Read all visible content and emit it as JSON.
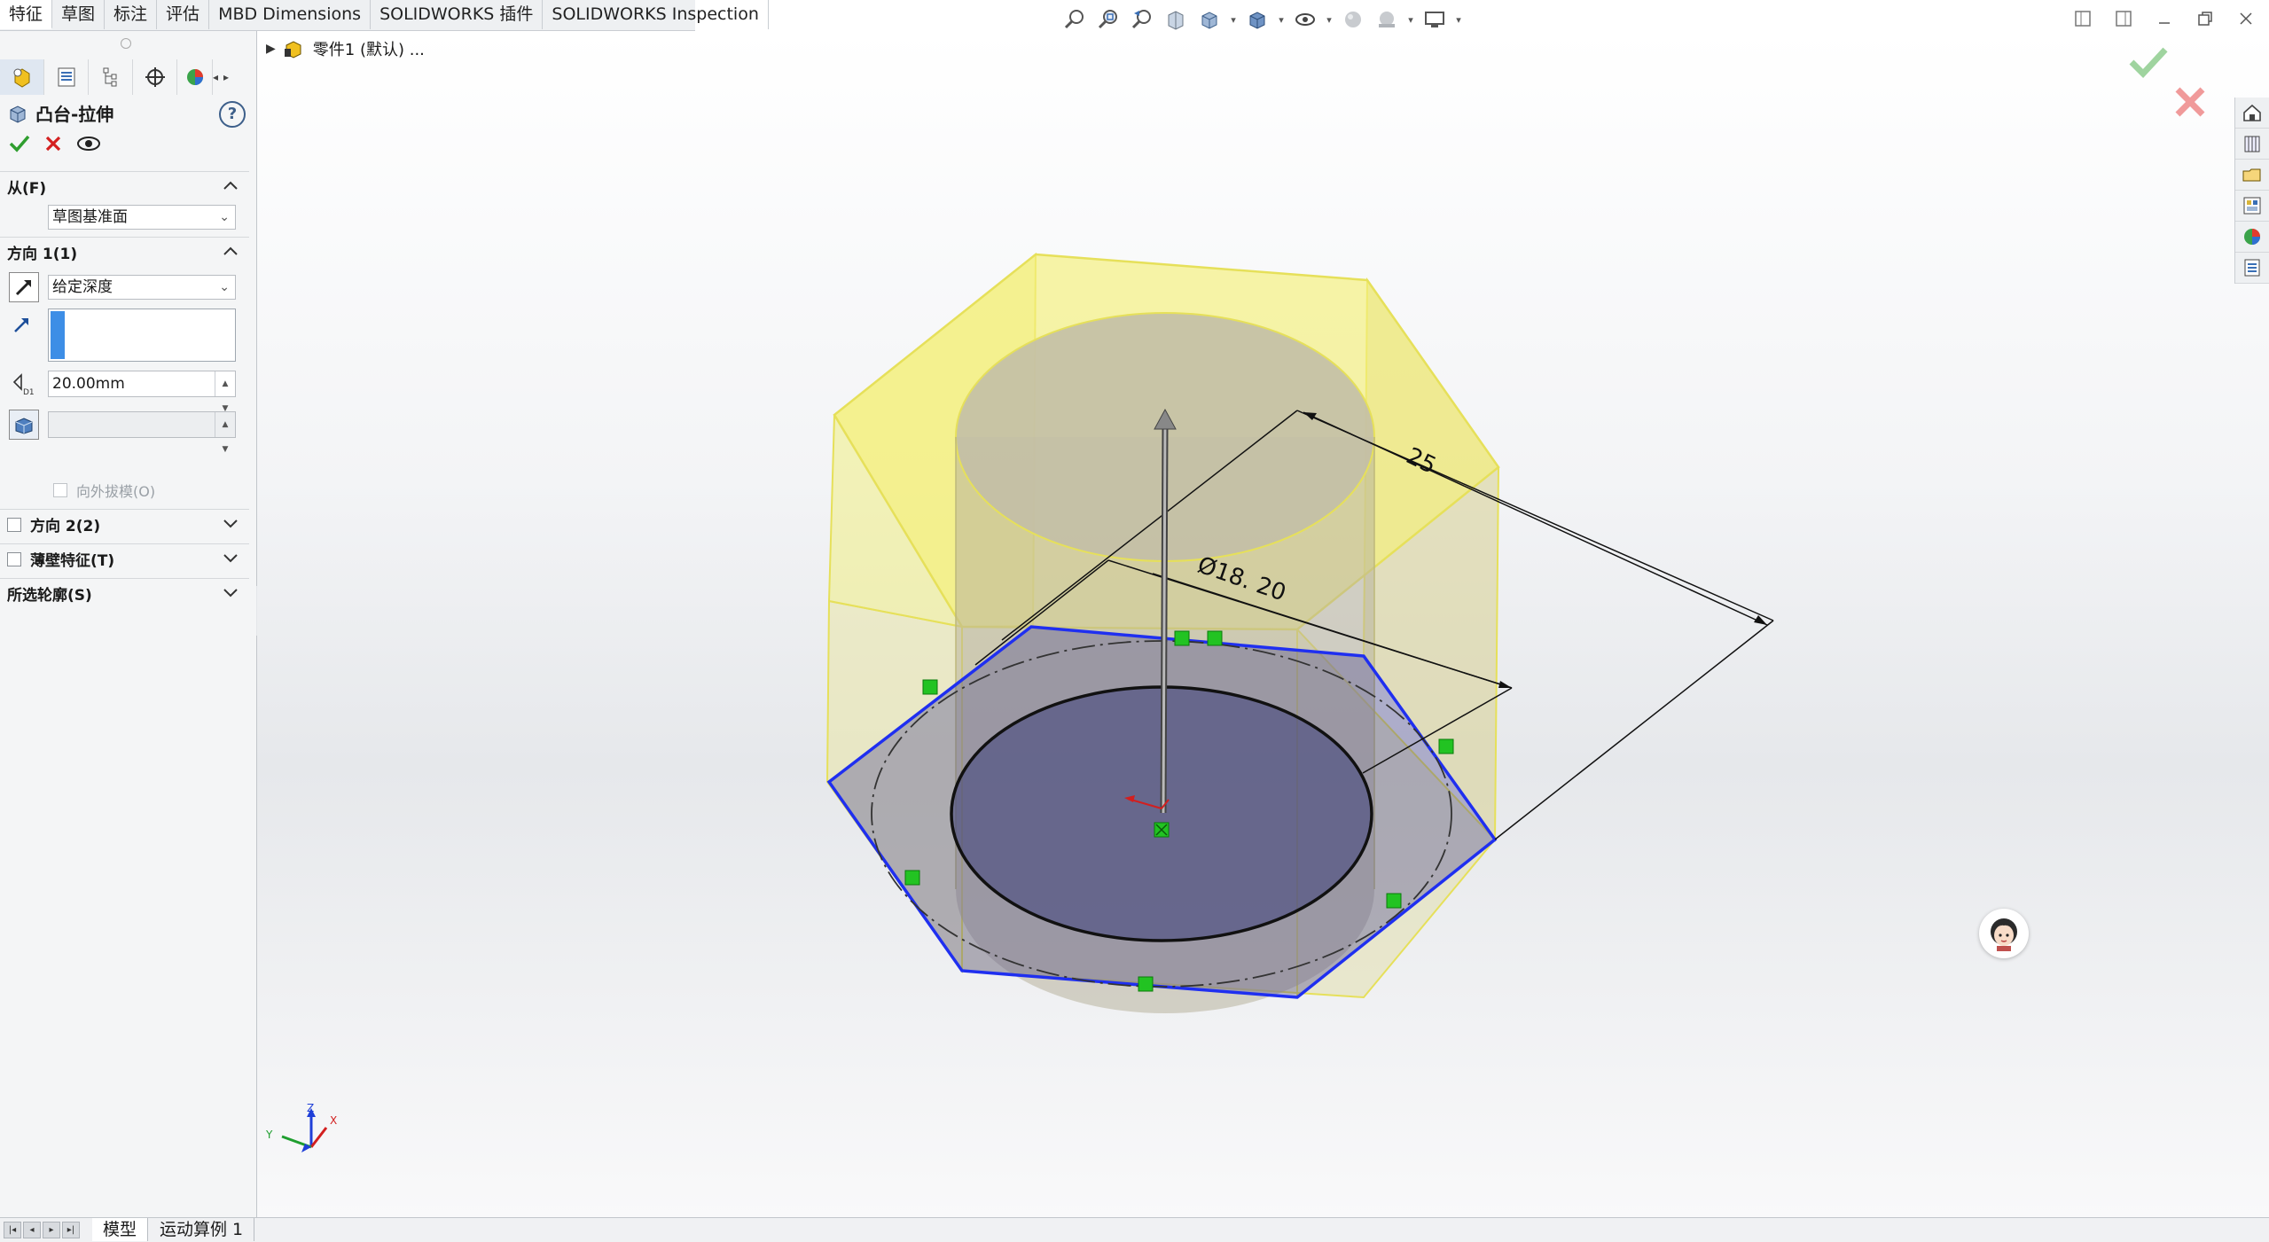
{
  "command_tabs": [
    "特征",
    "草图",
    "标注",
    "评估",
    "MBD Dimensions",
    "SOLIDWORKS 插件",
    "SOLIDWORKS Inspection"
  ],
  "active_tab_index": 0,
  "heads_up_toolbar": [
    "zoom-to-fit-icon",
    "zoom-to-area-icon",
    "previous-view-icon",
    "section-view-icon",
    "view-orientation-icon",
    "display-style-icon",
    "hide-show-items-icon",
    "edit-appearance-icon",
    "apply-scene-icon",
    "view-settings-icon"
  ],
  "feature_tree": {
    "part_label": "零件1 (默认) ..."
  },
  "property_manager": {
    "title": "凸台-拉伸",
    "from": {
      "label": "从(F)",
      "value": "草图基准面"
    },
    "direction1": {
      "label": "方向 1(1)",
      "end_condition": "给定深度",
      "depth": "20.00mm",
      "draft_outward_label": "向外拔模(O)"
    },
    "direction2_label": "方向 2(2)",
    "thin_feature_label": "薄壁特征(T)",
    "selected_contours_label": "所选轮廓(S)"
  },
  "model_annotations": {
    "dim_across_flats": "25",
    "dim_diameter": "Ø18. 20"
  },
  "triad": {
    "x": "X",
    "y": "Y",
    "z": "Z"
  },
  "bottom_tabs": [
    "模型",
    "运动算例 1"
  ],
  "colors": {
    "accent": "#1f5fbf",
    "preview_yellow": "#f5f06a",
    "sketch_blue": "#1f2ff0",
    "ok_green": "#2f9e2f",
    "cancel_red": "#d42020"
  }
}
